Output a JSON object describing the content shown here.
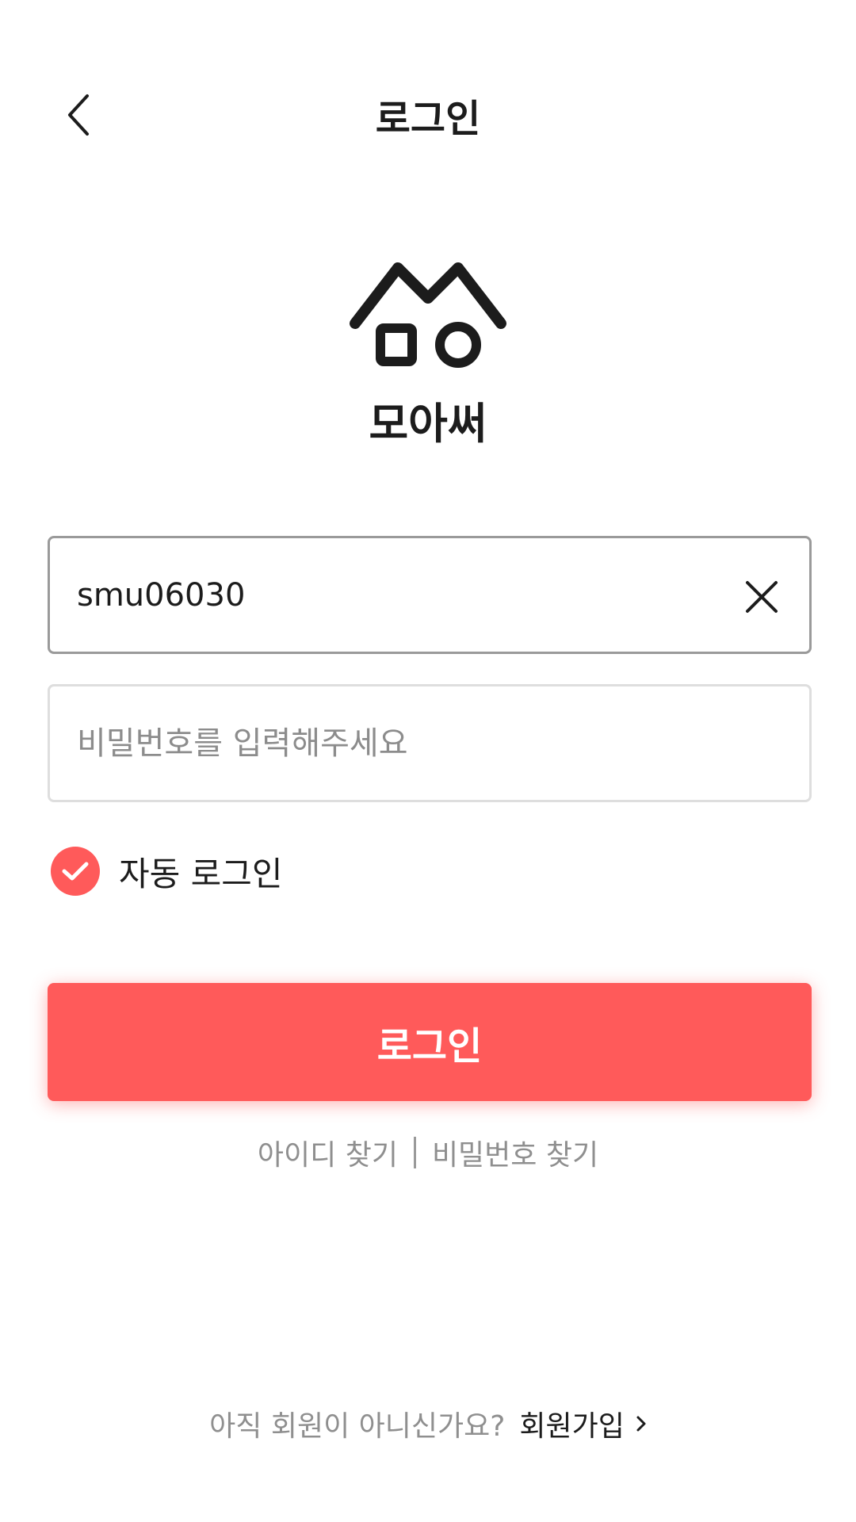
{
  "header": {
    "title": "로그인",
    "back_icon": "chevron-left-icon"
  },
  "brand": {
    "logo_icon": "house-logo-icon",
    "name": "모아써"
  },
  "form": {
    "id_value": "smu06030",
    "clear_icon": "close-icon",
    "password_placeholder": "비밀번호를 입력해주세요",
    "auto_login_label": "자동 로그인",
    "auto_login_checked": true,
    "login_button_label": "로그인"
  },
  "links": {
    "find_id": "아이디 찾기",
    "find_password": "비밀번호 찾기"
  },
  "signup": {
    "question": "아직 회원이 아니신가요?",
    "link_label": "회원가입"
  },
  "colors": {
    "accent": "#ff5a5a",
    "text": "#1c1c1c",
    "muted": "#8f8f8f"
  }
}
